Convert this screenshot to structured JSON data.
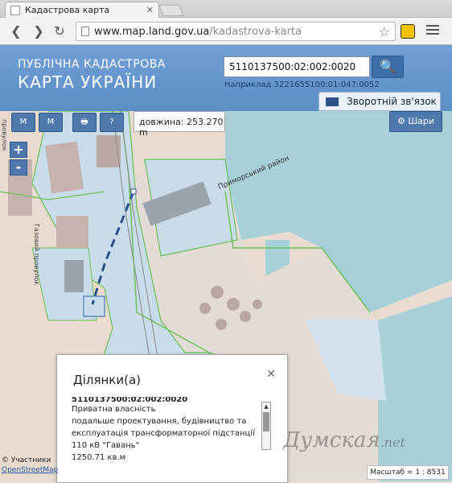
{
  "browser": {
    "tab_title": "Кадастрова карта",
    "tab_close": "✕",
    "url_host": "www.map.land.gov.ua",
    "url_path": "/kadastrova-karta",
    "back_icon": "❮",
    "forward_icon": "❯",
    "reload_icon": "↻",
    "star_icon": "☆"
  },
  "header": {
    "logo_top": "ПУБЛІЧНА КАДАСТРОВА",
    "logo_bottom": "КАРТА УКРАЇНИ",
    "search_value": "5110137500:02:002:0020",
    "search_icon": "🔍",
    "search_hint": "Наприклад 3221655100:01:047:0052",
    "feedback_label": "Зворотній зв'язок"
  },
  "map": {
    "tools": [
      "M",
      "M",
      "🖶",
      "?"
    ],
    "measure_label": "довжина: 253.270 m",
    "layers_label": "⚙ Шари",
    "zoom_in": "+",
    "zoom_out": "-",
    "district_label": "Приморський район",
    "street_label": "Газовий провулок",
    "street_label_2": "провулок",
    "attribution_prefix": "© Участники",
    "attribution_link": "OpenStreetMap",
    "scale_label": "Масштаб = 1 : 8531",
    "watermark": "Думская",
    "watermark_tld": ".net"
  },
  "popup": {
    "title": "Ділянки(а)",
    "close": "✕",
    "cadastral": "5110137500:02:002:0020",
    "ownership": "Приватна власність",
    "purpose": "подальше проектування, будівництво та експлуатація трансформаторної підстанції 110 кВ \"Гавань\"",
    "area": "1250.71 кв.м"
  },
  "colors": {
    "header_bg": "#6f9fd4",
    "button_blue": "#4f79ad",
    "parcel_fill": "#c9dcea",
    "water": "#a7d0d9",
    "parcel_border": "#6bbf57"
  }
}
